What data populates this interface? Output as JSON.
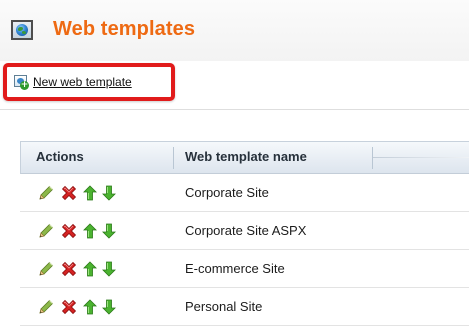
{
  "header": {
    "title": "Web templates",
    "icon": "globe-icon"
  },
  "toolbar": {
    "new_label": "New web template",
    "new_icon": "new-document-icon",
    "highlight_color": "#e11b1b"
  },
  "grid": {
    "columns": [
      "Actions",
      "Web template name"
    ],
    "rows": [
      {
        "name": "Corporate Site",
        "actions": [
          "edit-icon",
          "delete-icon",
          "move-up-icon",
          "move-down-icon"
        ]
      },
      {
        "name": "Corporate Site ASPX",
        "actions": [
          "edit-icon",
          "delete-icon",
          "move-up-icon",
          "move-down-icon"
        ]
      },
      {
        "name": "E-commerce Site",
        "actions": [
          "edit-icon",
          "delete-icon",
          "move-up-icon",
          "move-down-icon"
        ]
      },
      {
        "name": "Personal Site",
        "actions": [
          "edit-icon",
          "delete-icon",
          "move-up-icon",
          "move-down-icon"
        ]
      }
    ]
  },
  "colors": {
    "title": "#ee6a13",
    "edit": "#7aa33a",
    "delete": "#cc2222",
    "arrow": "#44a828"
  }
}
